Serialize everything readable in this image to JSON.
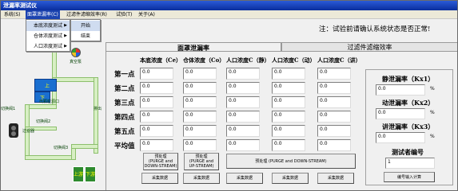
{
  "window": {
    "title": "泄漏率测试仪"
  },
  "menubar": {
    "items": [
      {
        "label": "系统(S)"
      },
      {
        "label": "面罩泄漏率(C)"
      },
      {
        "label": "过滤件滤缩效率(R)"
      },
      {
        "label": "试验(T)"
      },
      {
        "label": "关于(A)"
      }
    ]
  },
  "dropdown1": {
    "items": [
      {
        "label": "本底浓度测试"
      },
      {
        "label": "仓体浓度测试"
      },
      {
        "label": "人口浓度测试"
      }
    ]
  },
  "dropdown2": {
    "items": [
      {
        "label": "开始"
      },
      {
        "label": "结束"
      }
    ]
  },
  "notice": "注：试验前请确认系统状态是否正常!",
  "diagram": {
    "top_label": "上",
    "mid_label": "下",
    "stream_labels": [
      "切换阀1",
      "出颗粒源口",
      "过滤器",
      "切换阀2",
      "切换阀3",
      "排出"
    ],
    "bottom_left": "上游",
    "bottom_right": "下游",
    "vacuum": "真空泵"
  },
  "tabs": [
    {
      "label": "面罩泄漏率"
    },
    {
      "label": "过滤件滤缩效率"
    }
  ],
  "table": {
    "columns": [
      "本底浓度（Ce）",
      "仓体浓度（Co）",
      "人口浓度C（静）",
      "人口浓度C（动）",
      "人口浓度C（讲）"
    ],
    "rows": [
      "第一点",
      "第二点",
      "第三点",
      "第四点",
      "第五点",
      "平均值"
    ],
    "cells": [
      [
        "0.0",
        "0.0",
        "0.0",
        "0.0",
        "0.0"
      ],
      [
        "0.0",
        "0.0",
        "0.0",
        "0.0",
        "0.0"
      ],
      [
        "0.0",
        "0.0",
        "0.0",
        "0.0",
        "0.0"
      ],
      [
        "0.0",
        "0.0",
        "0.0",
        "0.0",
        "0.0"
      ],
      [
        "0.0",
        "0.0",
        "0.0",
        "0.0",
        "0.0"
      ],
      [
        "0.0",
        "0.0",
        "0.0",
        "0.0",
        "0.0"
      ]
    ]
  },
  "buttons": {
    "pre1": [
      "预处理",
      "(PURGE and",
      "DOWN-STREAM)"
    ],
    "pre2": [
      "预处理",
      "(PURGE and",
      "UP-STREAM)"
    ],
    "pre3": "预处理 (PURGE and DOWN-STREAM)",
    "collect": "采集数据",
    "calc": "编号输入计算"
  },
  "right": {
    "static_label": "静泄漏率（Kx1）",
    "static_value": "0.0",
    "dynamic_label": "动泄漏率（Kx2）",
    "dynamic_value": "0.0",
    "speak_label": "讲泄漏率（Kx3）",
    "speak_value": "0.0",
    "pct": "%",
    "tester_label": "测试者编号",
    "tester_value": "1"
  }
}
